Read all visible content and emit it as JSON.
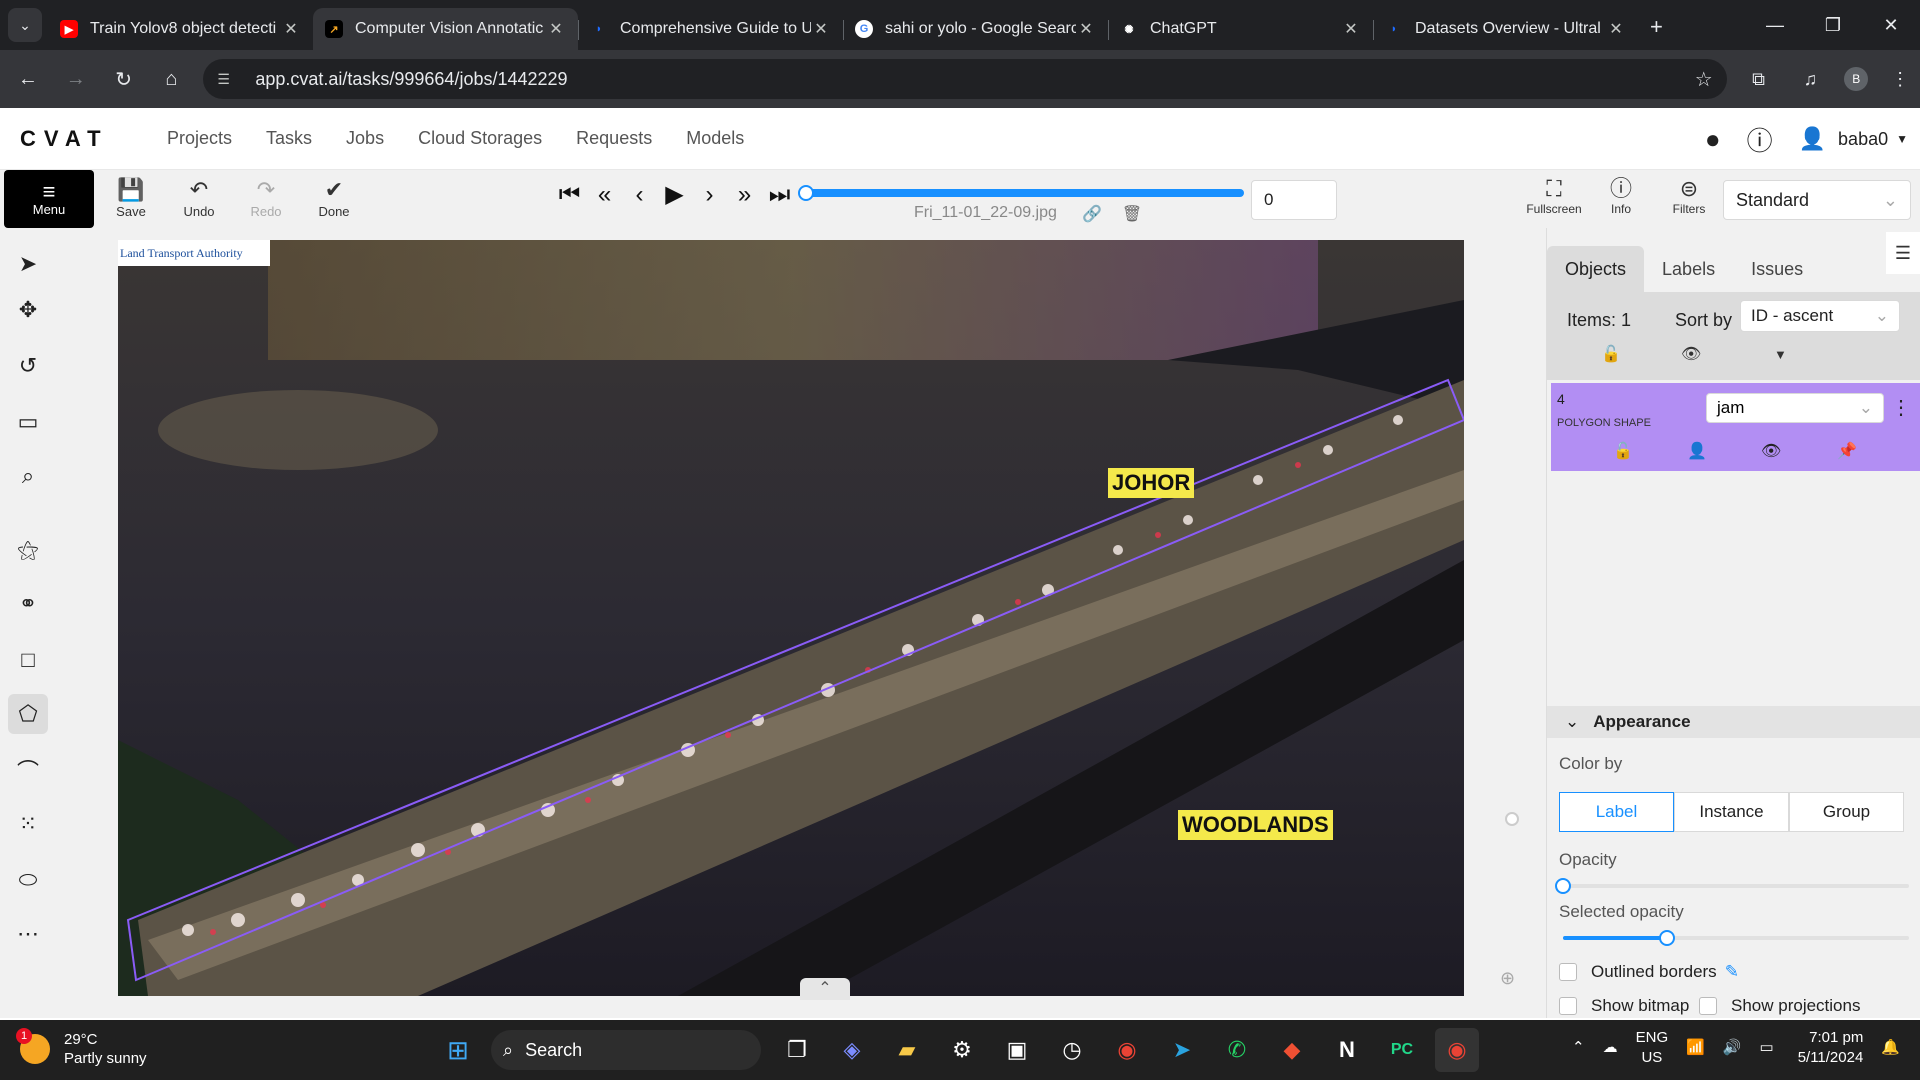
{
  "browser": {
    "tabs": [
      {
        "title": "Train Yolov8 object detecti",
        "icon": "youtube-icon",
        "active": false
      },
      {
        "title": "Computer Vision Annotatic",
        "icon": "cvat-icon",
        "active": true
      },
      {
        "title": "Comprehensive Guide to U",
        "icon": "ultralytics-icon",
        "active": false
      },
      {
        "title": "sahi or yolo - Google Searc",
        "icon": "google-icon",
        "active": false
      },
      {
        "title": "ChatGPT",
        "icon": "chatgpt-icon",
        "active": false
      },
      {
        "title": "Datasets Overview - Ultral",
        "icon": "ultralytics-icon",
        "active": false
      }
    ],
    "url": "app.cvat.ai/tasks/999664/jobs/1442229",
    "profile_initial": "B"
  },
  "cvat": {
    "logo": "CVAT",
    "nav": [
      "Projects",
      "Tasks",
      "Jobs",
      "Cloud Storages",
      "Requests",
      "Models"
    ],
    "username": "baba0"
  },
  "toolbar": {
    "menu": "Menu",
    "save": "Save",
    "undo": "Undo",
    "redo": "Redo",
    "done": "Done",
    "frame_name": "Fri_11-01_22-09.jpg",
    "frame_number": "0",
    "frame_progress": 0,
    "fullscreen": "Fullscreen",
    "info": "Info",
    "filters": "Filters",
    "workspace": "Standard"
  },
  "canvas": {
    "watermark": "Land Transport Authority",
    "labels": [
      "JOHOR",
      "WOODLANDS"
    ]
  },
  "sidebar": {
    "tabs": [
      "Objects",
      "Labels",
      "Issues"
    ],
    "items_count": "Items: 1",
    "sort_label": "Sort by",
    "sort_value": "ID - ascent",
    "object": {
      "id": "4",
      "type": "POLYGON SHAPE",
      "label": "jam",
      "color": "#b28ef3"
    },
    "appearance": {
      "title": "Appearance",
      "color_by_label": "Color by",
      "color_by_options": [
        "Label",
        "Instance",
        "Group"
      ],
      "color_by_selected": "Label",
      "opacity_label": "Opacity",
      "opacity_value": 0,
      "selected_opacity_label": "Selected opacity",
      "selected_opacity_value": 0.3,
      "outlined_borders": "Outlined borders",
      "show_bitmap": "Show bitmap",
      "show_projections": "Show projections"
    }
  },
  "taskbar": {
    "temperature": "29°C",
    "weather": "Partly sunny",
    "weather_badge": "1",
    "search": "Search",
    "lang_top": "ENG",
    "lang_bottom": "US",
    "time": "7:01 pm",
    "date": "5/11/2024"
  }
}
